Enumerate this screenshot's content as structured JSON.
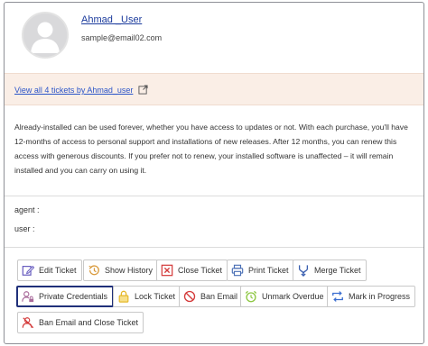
{
  "user": {
    "name": "Ahmad _User",
    "email": "sample@email02.com"
  },
  "tickets_link": "View all 4 tickets by Ahmad_user",
  "description": "Already-installed can be used forever, whether you have access to updates or not. With each purchase, you'll have 12-months of access to personal support and installations of new releases. After 12 months, you can renew this access with generous discounts. If you prefer not to renew, your installed software is unaffected – it will remain installed and you can carry on using it.",
  "meta": {
    "agent_label": "agent :",
    "user_label": "user :"
  },
  "actions": {
    "edit_ticket": "Edit Ticket",
    "show_history": "Show History",
    "close_ticket": "Close Ticket",
    "print_ticket": "Print Ticket",
    "merge_ticket": "Merge Ticket",
    "private_credentials": "Private Credentials",
    "lock_ticket": "Lock Ticket",
    "ban_email": "Ban Email",
    "unmark_overdue": "Unmark Overdue",
    "mark_in_progress": "Mark in Progress",
    "ban_email_close_ticket": "Ban Email and Close Ticket"
  },
  "icons": {
    "edit": "edit-icon",
    "history": "history-icon",
    "close": "close-box-icon",
    "print": "printer-icon",
    "merge": "merge-icon",
    "credentials": "user-lock-icon",
    "lock": "lock-icon",
    "ban": "ban-icon",
    "overdue": "alarm-clock-icon",
    "progress": "progress-arrows-icon",
    "ban_close": "user-ban-icon"
  },
  "colors": {
    "link": "#2b55c8",
    "user_name": "#1a3a9c",
    "tickets_bar_bg": "#faeee6",
    "highlight_border": "#20307a",
    "edit_icon": "#6a5fc0",
    "history_icon": "#d99a3c",
    "close_icon": "#d43a3a",
    "print_icon": "#4a6fb5",
    "merge_icon": "#3a5fb0",
    "credentials_icon": "#a86a9a",
    "lock_icon": "#e5b82a",
    "ban_icon": "#d43a3a",
    "overdue_icon": "#8cc63f",
    "progress_icon": "#3a6ed0"
  }
}
